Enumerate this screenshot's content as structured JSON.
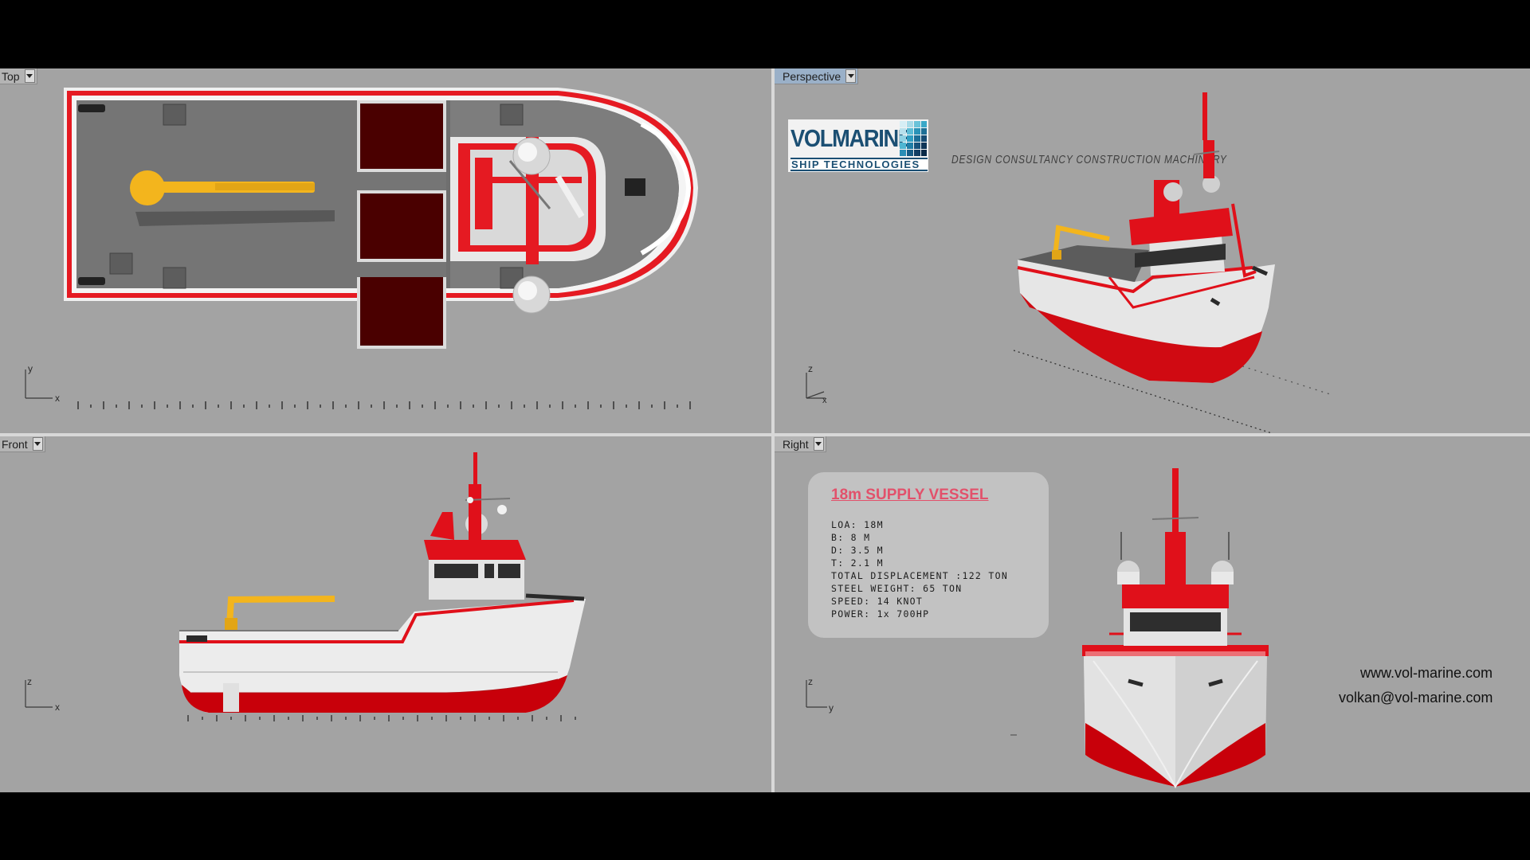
{
  "viewports": {
    "top": {
      "label": "Top"
    },
    "perspective": {
      "label": "Perspective"
    },
    "front": {
      "label": "Front"
    },
    "right": {
      "label": "Right"
    }
  },
  "axes": {
    "top": {
      "v": "y",
      "h": "x"
    },
    "perspective": {
      "v": "z",
      "h": "x"
    },
    "front": {
      "v": "z",
      "h": "x"
    },
    "right": {
      "v": "z",
      "h": "y"
    }
  },
  "logo": {
    "wordmark": "VOLMARINE",
    "tagline_box": "SHIP TECHNOLOGIES",
    "services": "DESIGN  CONSULTANCY  CONSTRUCTION  MACHINERY"
  },
  "specs": {
    "title": "18m SUPPLY VESSEL",
    "lines": [
      "LOA: 18M",
      "B: 8 M",
      "D: 3.5 M",
      "T: 2.1 M",
      "TOTAL DISPLACEMENT :122 TON",
      "STEEL WEIGHT: 65 TON",
      "SPEED:  14 KNOT",
      "POWER:  1x 700HP"
    ]
  },
  "contact": {
    "website": "www.vol-marine.com",
    "email": "volkan@vol-marine.com"
  },
  "colors": {
    "viewport_bg": "#a3a3a3",
    "hull_red": "#e0101a",
    "crane_yellow": "#f3b51d",
    "brand_blue": "#1b4f73",
    "spec_title": "#e2516b"
  },
  "icons": [
    "chevron-down-icon",
    "axis-gizmo-icon"
  ]
}
